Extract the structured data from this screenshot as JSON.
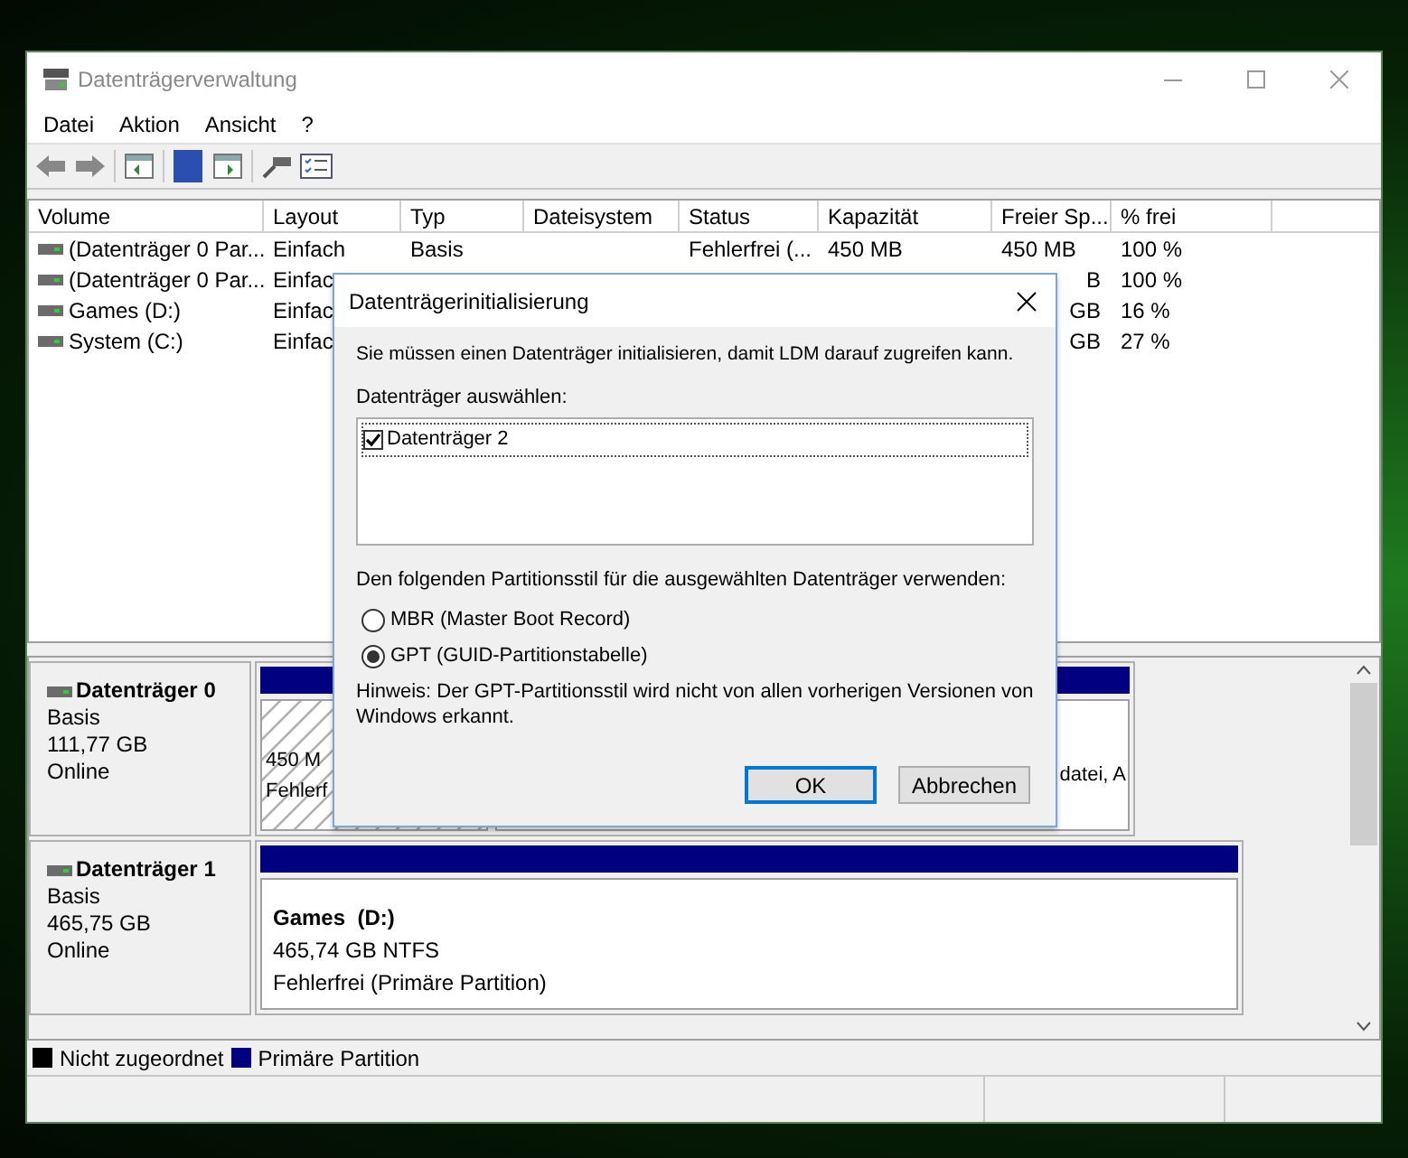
{
  "window": {
    "title": "Datenträgerverwaltung"
  },
  "menu": [
    "Datei",
    "Aktion",
    "Ansicht",
    "?"
  ],
  "table": {
    "columns": [
      "Volume",
      "Layout",
      "Typ",
      "Dateisystem",
      "Status",
      "Kapazität",
      "Freier Sp...",
      "% frei"
    ],
    "rows": [
      [
        "(Datenträger 0 Par...",
        "Einfach",
        "Basis",
        null,
        "Fehlerfrei (...",
        "450 MB",
        "450 MB",
        "100 %"
      ],
      [
        "(Datenträger 0 Par...",
        "Einfac",
        null,
        null,
        null,
        null,
        "B",
        "100 %"
      ],
      [
        "Games (D:)",
        "Einfac",
        null,
        null,
        null,
        null,
        "GB",
        "16 %"
      ],
      [
        "System (C:)",
        "Einfac",
        null,
        null,
        null,
        null,
        "GB",
        "27 %"
      ]
    ]
  },
  "disks": [
    {
      "name": "Datenträger 0",
      "type": "Basis",
      "size": "111,77 GB",
      "status": "Online",
      "partitions": [
        {
          "kind": "hatched",
          "lines": [
            "450 M",
            "Fehlerf"
          ]
        },
        {
          "kind": "primary",
          "lines": [
            "datei, A"
          ]
        }
      ]
    },
    {
      "name": "Datenträger 1",
      "type": "Basis",
      "size": "465,75 GB",
      "status": "Online",
      "partitions": [
        {
          "kind": "primary",
          "title": "Games  (D:)",
          "lines": [
            "465,74 GB NTFS",
            "Fehlerfrei (Primäre Partition)"
          ]
        }
      ]
    }
  ],
  "legend": [
    {
      "label": "Nicht zugeordnet",
      "color": "#000000"
    },
    {
      "label": "Primäre Partition",
      "color": "#000080"
    }
  ],
  "dialog": {
    "title": "Datenträgerinitialisierung",
    "intro": "Sie müssen einen Datenträger initialisieren, damit LDM darauf zugreifen kann.",
    "select_label": "Datenträger auswählen:",
    "disks": [
      {
        "label": "Datenträger 2",
        "checked": true
      }
    ],
    "style_label": "Den folgenden Partitionsstil für die ausgewählten Datenträger verwenden:",
    "styles": [
      {
        "label": "MBR (Master Boot Record)",
        "selected": false
      },
      {
        "label": "GPT (GUID-Partitionstabelle)",
        "selected": true
      }
    ],
    "note": "Hinweis: Der GPT-Partitionsstil wird nicht von allen vorherigen Versionen von Windows erkannt.",
    "buttons": [
      {
        "label": "OK",
        "default": true
      },
      {
        "label": "Abbrechen",
        "default": false
      }
    ]
  }
}
